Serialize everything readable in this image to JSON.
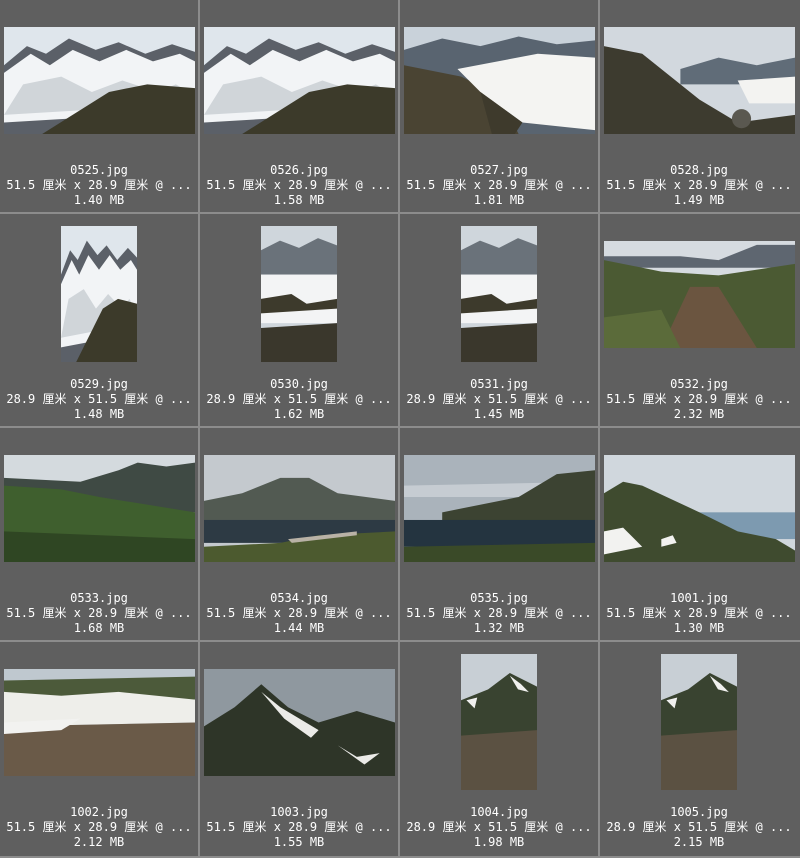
{
  "thumbnails": [
    {
      "filename": "0525.jpg",
      "dimensions": "51.5 厘米 x 28.9 厘米 @ ...",
      "size": "1.40 MB",
      "orientation": "landscape",
      "scene": "snowy-mountain"
    },
    {
      "filename": "0526.jpg",
      "dimensions": "51.5 厘米 x 28.9 厘米 @ ...",
      "size": "1.58 MB",
      "orientation": "landscape",
      "scene": "snowy-mountain"
    },
    {
      "filename": "0527.jpg",
      "dimensions": "51.5 厘米 x 28.9 厘米 @ ...",
      "size": "1.81 MB",
      "orientation": "landscape",
      "scene": "snow-slope"
    },
    {
      "filename": "0528.jpg",
      "dimensions": "51.5 厘米 x 28.9 厘米 @ ...",
      "size": "1.49 MB",
      "orientation": "landscape",
      "scene": "rocky-ridge"
    },
    {
      "filename": "0529.jpg",
      "dimensions": "28.9 厘米 x 51.5 厘米 @ ...",
      "size": "1.48 MB",
      "orientation": "portrait",
      "scene": "snowy-mountain"
    },
    {
      "filename": "0530.jpg",
      "dimensions": "28.9 厘米 x 51.5 厘米 @ ...",
      "size": "1.62 MB",
      "orientation": "portrait",
      "scene": "snow-field"
    },
    {
      "filename": "0531.jpg",
      "dimensions": "28.9 厘米 x 51.5 厘米 @ ...",
      "size": "1.45 MB",
      "orientation": "portrait",
      "scene": "snow-field"
    },
    {
      "filename": "0532.jpg",
      "dimensions": "51.5 厘米 x 28.9 厘米 @ ...",
      "size": "2.32 MB",
      "orientation": "landscape",
      "scene": "dirt-track"
    },
    {
      "filename": "0533.jpg",
      "dimensions": "51.5 厘米 x 28.9 厘米 @ ...",
      "size": "1.68 MB",
      "orientation": "landscape",
      "scene": "green-valley"
    },
    {
      "filename": "0534.jpg",
      "dimensions": "51.5 厘米 x 28.9 厘米 @ ...",
      "size": "1.44 MB",
      "orientation": "landscape",
      "scene": "fjord-town"
    },
    {
      "filename": "0535.jpg",
      "dimensions": "51.5 厘米 x 28.9 厘米 @ ...",
      "size": "1.32 MB",
      "orientation": "landscape",
      "scene": "fjord"
    },
    {
      "filename": "1001.jpg",
      "dimensions": "51.5 厘米 x 28.9 厘米 @ ...",
      "size": "1.30 MB",
      "orientation": "landscape",
      "scene": "green-peak"
    },
    {
      "filename": "1002.jpg",
      "dimensions": "51.5 厘米 x 28.9 厘米 @ ...",
      "size": "2.12 MB",
      "orientation": "landscape",
      "scene": "rocky-snow"
    },
    {
      "filename": "1003.jpg",
      "dimensions": "51.5 厘米 x 28.9 厘米 @ ...",
      "size": "1.55 MB",
      "orientation": "landscape",
      "scene": "dark-peak"
    },
    {
      "filename": "1004.jpg",
      "dimensions": "28.9 厘米 x 51.5 厘米 @ ...",
      "size": "1.98 MB",
      "orientation": "portrait",
      "scene": "peak-portrait"
    },
    {
      "filename": "1005.jpg",
      "dimensions": "28.9 厘米 x 51.5 厘米 @ ...",
      "size": "2.15 MB",
      "orientation": "portrait",
      "scene": "peak-portrait"
    }
  ],
  "colors": {
    "panel": "#8c8c8c",
    "cell": "#5f5f5f",
    "text": "#ffffff"
  }
}
